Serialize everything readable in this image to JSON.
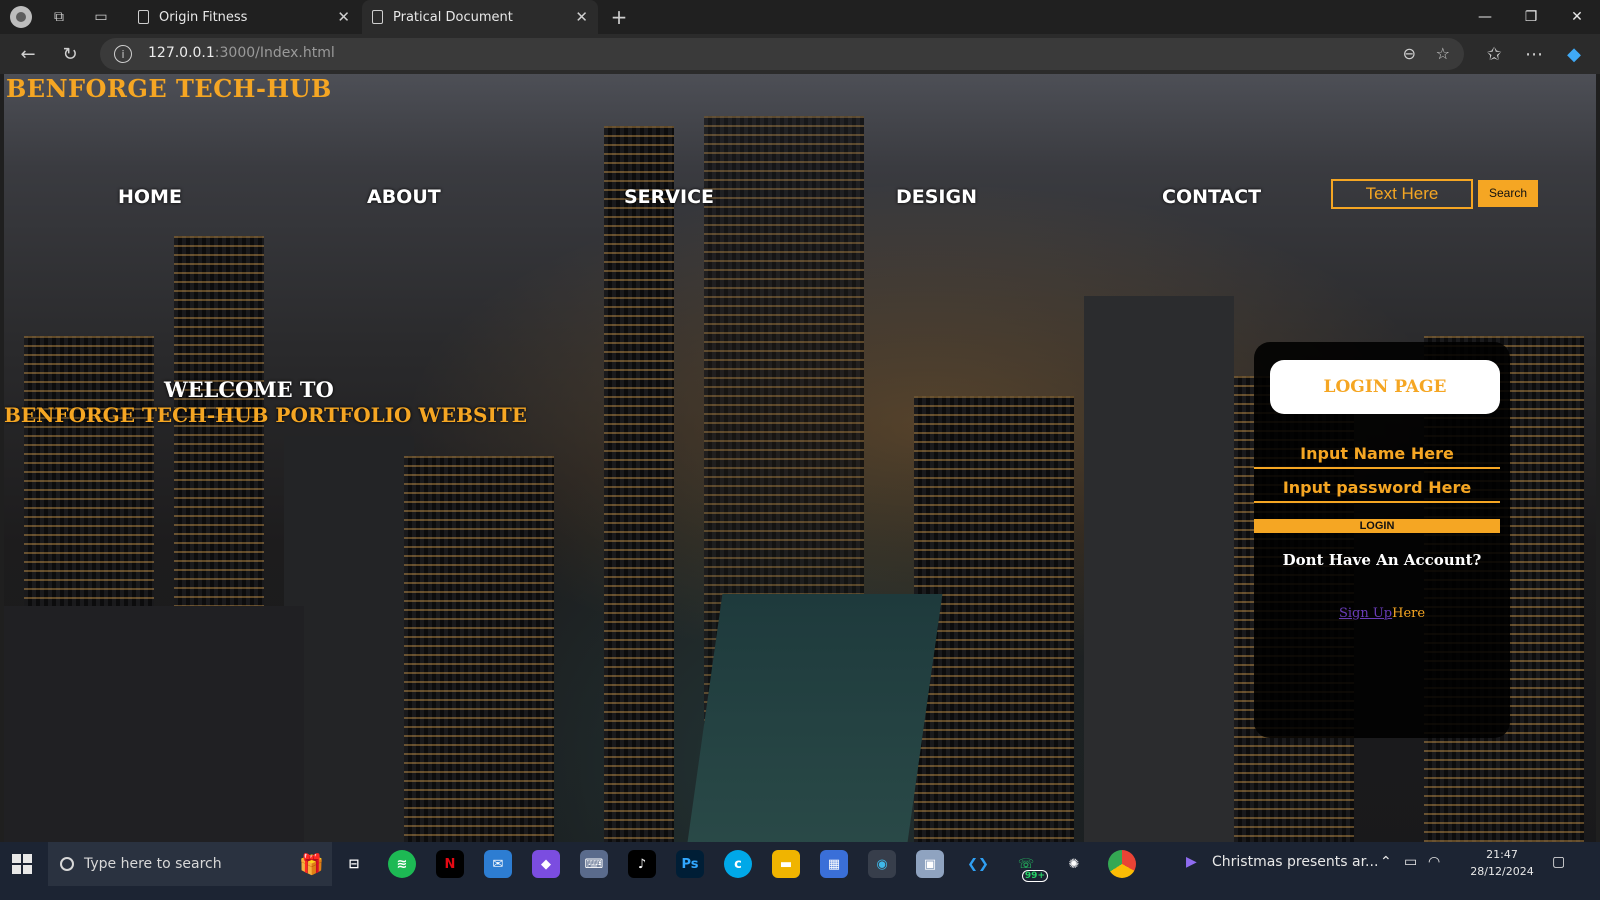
{
  "browser": {
    "tabs": [
      {
        "title": "Origin Fitness",
        "active": false
      },
      {
        "title": "Pratical Document",
        "active": true
      }
    ],
    "address": {
      "host": "127.0.0.1",
      "path": ":3000/Index.html"
    }
  },
  "site": {
    "title": "BENFORGE TECH-HUB",
    "menu": [
      "HOME",
      "ABOUT",
      "SERVICE",
      "DESIGN",
      "CONTACT"
    ],
    "search_placeholder": "Text Here",
    "search_button": "Search",
    "welcome_line1": "WELCOME TO",
    "welcome_line2": "BENFORGE TECH-HUB PORTFOLIO WEBSITE",
    "accent_color": "#f5a623"
  },
  "login": {
    "title": "LOGIN PAGE",
    "name_placeholder": "Input Name Here",
    "password_placeholder": "Input password Here",
    "login_button": "LOGIN",
    "no_account": "Dont Have An Account?",
    "signup_link": "Sign Up",
    "signup_suffix": "Here"
  },
  "taskbar": {
    "search_placeholder": "Type here to search",
    "notification": "Christmas presents ar...",
    "time": "21:47",
    "date": "28/12/2024",
    "whatsapp_badge": "99+"
  }
}
